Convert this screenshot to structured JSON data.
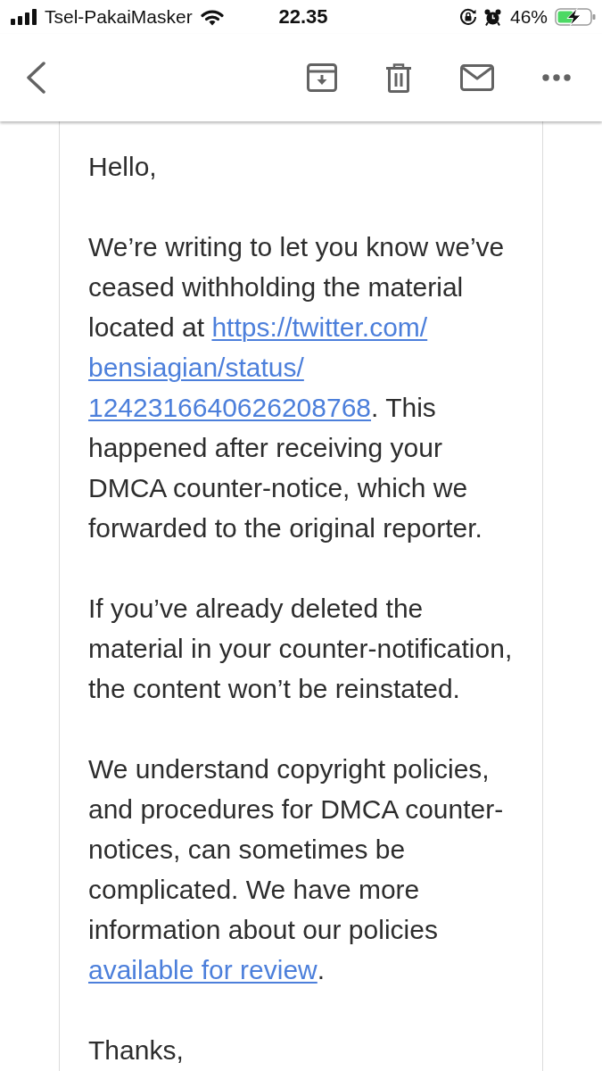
{
  "status_bar": {
    "carrier": "Tsel-PakaiMasker",
    "time": "22.35",
    "battery": "46%"
  },
  "email": {
    "paragraphs": [
      {
        "runs": [
          {
            "kind": "text",
            "text": "Hello,"
          }
        ]
      },
      {
        "runs": [
          {
            "kind": "text",
            "text": "We’re writing to let you know we’ve ceased withholding the material located at "
          },
          {
            "kind": "link",
            "text": "https://twitter.com/"
          },
          {
            "kind": "link",
            "text": "bensiagian/status/"
          },
          {
            "kind": "link",
            "text": "1242316640626208768"
          },
          {
            "kind": "text",
            "text": ". This happened after receiving your DMCA counter-notice, which we forwarded to the original reporter."
          }
        ]
      },
      {
        "runs": [
          {
            "kind": "text",
            "text": "If you’ve already deleted the material in your counter-notification, the content won’t be reinstated."
          }
        ]
      },
      {
        "runs": [
          {
            "kind": "text",
            "text": "We understand copyright policies, and procedures for DMCA counter-notices, can sometimes be complicated. We have more information about our policies "
          },
          {
            "kind": "link",
            "text": "available for review"
          },
          {
            "kind": "text",
            "text": "."
          }
        ]
      },
      {
        "runs": [
          {
            "kind": "text",
            "text": "Thanks,"
          }
        ]
      }
    ]
  }
}
